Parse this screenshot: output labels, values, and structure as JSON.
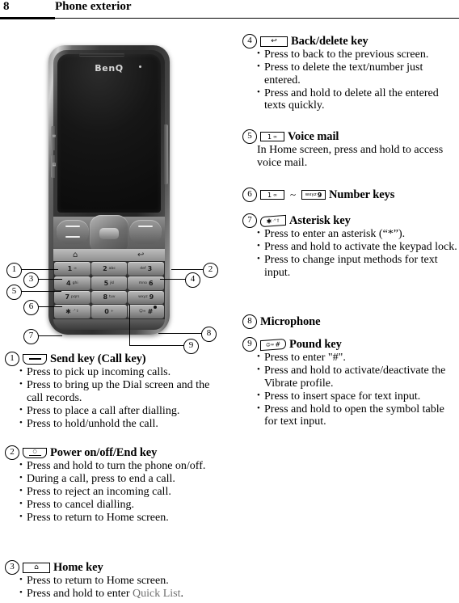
{
  "header": {
    "page_number": "8",
    "title": "Phone exterior"
  },
  "figure": {
    "brand": "BenQ",
    "callouts": [
      "1",
      "2",
      "3",
      "4",
      "5",
      "6",
      "7",
      "8",
      "9"
    ],
    "keypad": [
      {
        "digit": "1",
        "sub": "∞",
        "sub_first": false
      },
      {
        "digit": "2",
        "sub": "abc",
        "sub_first": false
      },
      {
        "digit": "3",
        "sub": "def",
        "sub_first": true
      },
      {
        "digit": "4",
        "sub": "ghi",
        "sub_first": false
      },
      {
        "digit": "5",
        "sub": "jkl",
        "sub_first": false
      },
      {
        "digit": "6",
        "sub": "mno",
        "sub_first": true
      },
      {
        "digit": "7",
        "sub": "pqrs",
        "sub_first": false
      },
      {
        "digit": "8",
        "sub": "tuv",
        "sub_first": false
      },
      {
        "digit": "9",
        "sub": "wxyz",
        "sub_first": true
      },
      {
        "digit": "✱",
        "sub": "·°⇧",
        "sub_first": false
      },
      {
        "digit": "0",
        "sub": "+",
        "sub_first": false
      },
      {
        "digit": "#",
        "sub": "☺≈",
        "sub_first": true
      }
    ],
    "home_glyph": "⌂",
    "back_glyph": "↩",
    "power_glyph": "⏻"
  },
  "entries": [
    {
      "num": "1",
      "icon": "send-key-icon",
      "title": "Send key (Call key)",
      "bullets": [
        "Press to pick up incoming calls.",
        "Press to bring up the Dial screen and the call records.",
        "Press to place a call after dialling.",
        "Press to hold/unhold the call."
      ]
    },
    {
      "num": "2",
      "icon": "power-end-key-icon",
      "title": "Power on/off/End key",
      "bullets": [
        "Press and hold to turn the phone on/off.",
        "During a call, press to end a call.",
        "Press to reject an incoming call.",
        "Press to cancel dialling.",
        "Press to return to Home screen."
      ]
    },
    {
      "num": "3",
      "icon": "home-key-icon",
      "title": "Home key",
      "bullets": [
        "Press to return to Home screen.",
        "Press and hold to enter Quick List."
      ],
      "bullet_last_highlight": "Quick List"
    },
    {
      "num": "4",
      "icon": "back-delete-key-icon",
      "title": "Back/delete key",
      "bullets": [
        "Press to back to the previous screen.",
        "Press to delete the text/number just entered.",
        "Press and hold to delete all the entered texts quickly."
      ]
    },
    {
      "num": "5",
      "icon": "voice-mail-key-icon",
      "title": "Voice mail",
      "paragraph": "In Home screen, press and hold to access voice mail."
    },
    {
      "num": "6",
      "icon": "number-keys-icon",
      "title": "Number keys",
      "range_separator": "~"
    },
    {
      "num": "7",
      "icon": "asterisk-key-icon",
      "title": "Asterisk key",
      "bullets": [
        "Press to enter an asterisk (“*”).",
        "Press and hold to activate the keypad lock.",
        "Press to change input methods for text input."
      ]
    },
    {
      "num": "8",
      "icon": "",
      "title": "Microphone"
    },
    {
      "num": "9",
      "icon": "pound-key-icon",
      "title": "Pound key",
      "bullets": [
        "Press to enter \"#\".",
        "Press and hold to activate/deactivate the Vibrate profile.",
        "Press to insert space for text input.",
        "Press and hold to open the symbol table for text input."
      ]
    }
  ]
}
